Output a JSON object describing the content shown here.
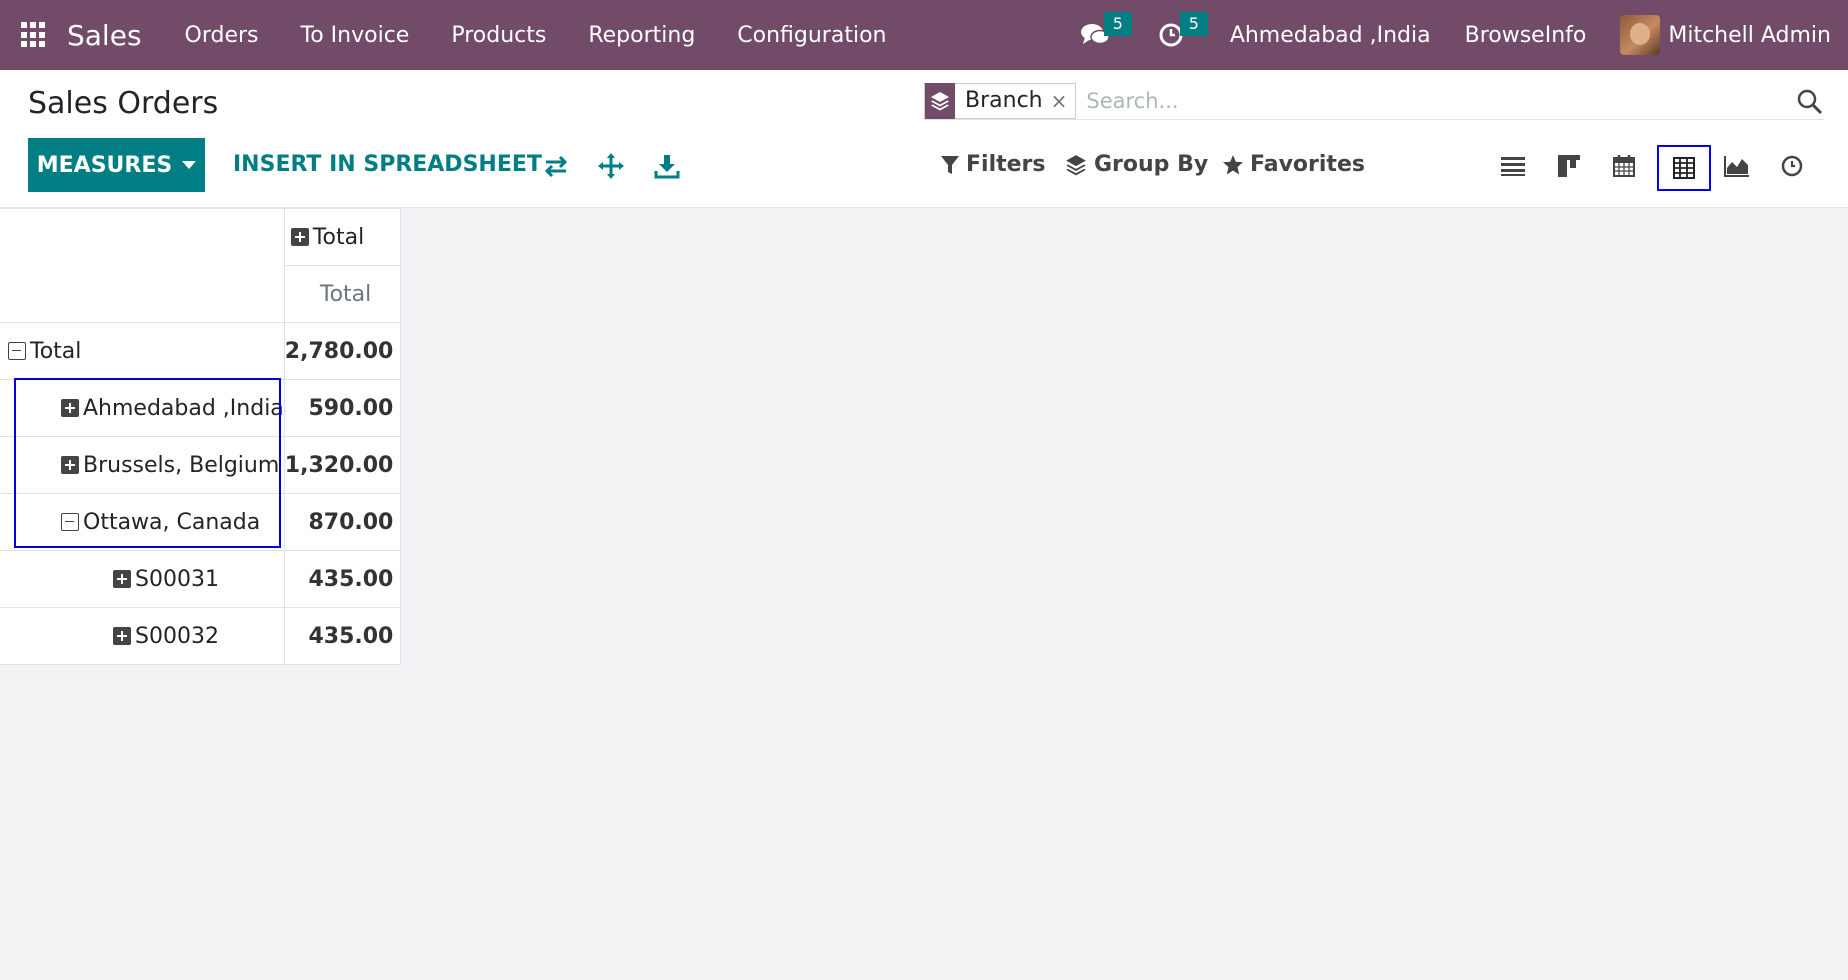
{
  "navbar": {
    "app_name": "Sales",
    "menu": [
      "Orders",
      "To Invoice",
      "Products",
      "Reporting",
      "Configuration"
    ],
    "messages_count": "5",
    "activities_count": "5",
    "company": "Ahmedabad ,India",
    "company2": "BrowseInfo",
    "user": "Mitchell Admin",
    "background": "#714b67"
  },
  "control_panel": {
    "title": "Sales Orders",
    "search": {
      "facet_value": "Branch",
      "placeholder": "Search..."
    },
    "measures_label": "MEASURES",
    "insert_spreadsheet_label": "INSERT IN SPREADSHEET",
    "filters_label": "Filters",
    "group_by_label": "Group By",
    "favorites_label": "Favorites",
    "tools": [
      "flip-axis-icon",
      "expand-all-icon",
      "download-icon"
    ],
    "views": [
      "list-view-icon",
      "kanban-view-icon",
      "calendar-view-icon",
      "pivot-view-icon",
      "graph-view-icon",
      "activity-view-icon"
    ],
    "active_view": "pivot-view-icon",
    "accent": "#017e84"
  },
  "pivot": {
    "col_header": "Total",
    "measure_header": "Total",
    "rows": [
      {
        "label": "Total",
        "value": "2,780.00",
        "expanded": true
      },
      {
        "label": "Ahmedabad ,India",
        "value": "590.00",
        "expanded": false
      },
      {
        "label": "Brussels, Belgium",
        "value": "1,320.00",
        "expanded": false
      },
      {
        "label": "Ottawa, Canada",
        "value": "870.00",
        "expanded": true
      },
      {
        "label": "S00031",
        "value": "435.00",
        "expanded": false
      },
      {
        "label": "S00032",
        "value": "435.00",
        "expanded": false
      }
    ]
  }
}
